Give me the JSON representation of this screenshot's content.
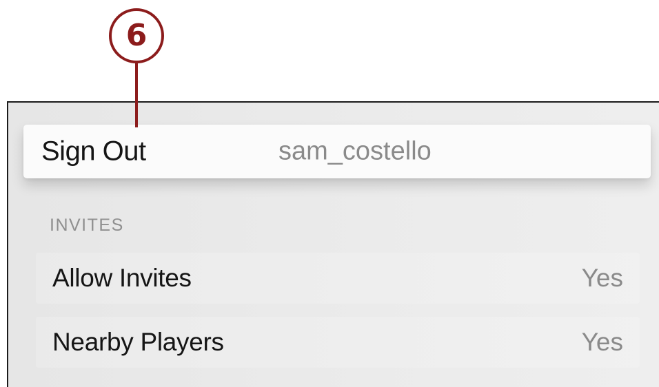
{
  "callout": {
    "number": "6",
    "color": "#8c1c1c"
  },
  "sign_out_row": {
    "label": "Sign Out",
    "account": "sam_costello"
  },
  "invites_section": {
    "header": "INVITES",
    "rows": [
      {
        "label": "Allow Invites",
        "value": "Yes"
      },
      {
        "label": "Nearby Players",
        "value": "Yes"
      }
    ]
  }
}
